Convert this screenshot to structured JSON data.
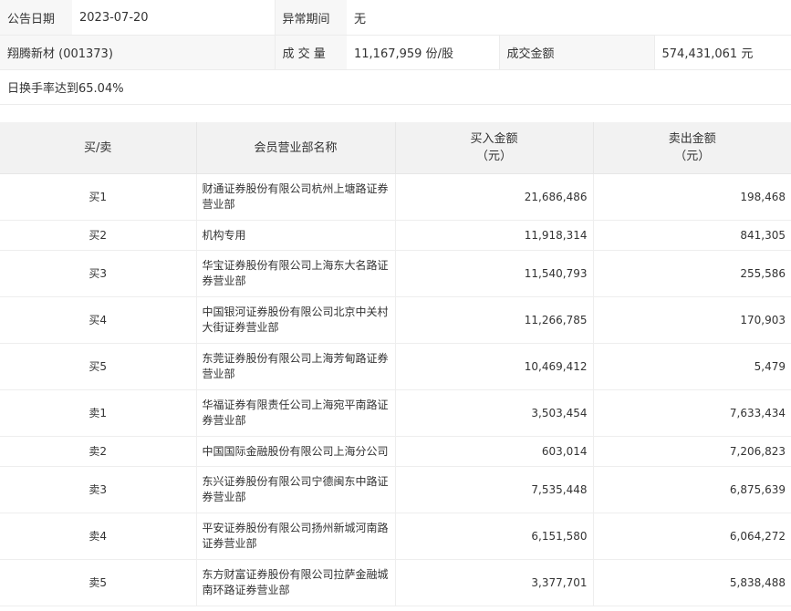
{
  "info": {
    "announce_date_label": "公告日期",
    "announce_date_value": "2023-07-20",
    "abnormal_period_label": "异常期间",
    "abnormal_period_value": "无",
    "stock": "翔腾新材 (001373)",
    "volume_label": "成 交 量",
    "volume_value": "11,167,959 份/股",
    "amount_label": "成交金额",
    "amount_value": "574,431,061 元",
    "reason": "日换手率达到65.04%"
  },
  "table": {
    "headers": {
      "side": "买/卖",
      "branch": "会员营业部名称",
      "buy_line1": "买入金额",
      "buy_line2": "（元）",
      "sell_line1": "卖出金额",
      "sell_line2": "（元）"
    },
    "rows": [
      {
        "side": "买1",
        "branch": "财通证券股份有限公司杭州上塘路证券营业部",
        "buy": "21,686,486",
        "sell": "198,468"
      },
      {
        "side": "买2",
        "branch": "机构专用",
        "buy": "11,918,314",
        "sell": "841,305"
      },
      {
        "side": "买3",
        "branch": "华宝证券股份有限公司上海东大名路证券营业部",
        "buy": "11,540,793",
        "sell": "255,586"
      },
      {
        "side": "买4",
        "branch": "中国银河证券股份有限公司北京中关村大街证券营业部",
        "buy": "11,266,785",
        "sell": "170,903"
      },
      {
        "side": "买5",
        "branch": "东莞证券股份有限公司上海芳甸路证券营业部",
        "buy": "10,469,412",
        "sell": "5,479"
      },
      {
        "side": "卖1",
        "branch": "华福证券有限责任公司上海宛平南路证券营业部",
        "buy": "3,503,454",
        "sell": "7,633,434"
      },
      {
        "side": "卖2",
        "branch": "中国国际金融股份有限公司上海分公司",
        "buy": "603,014",
        "sell": "7,206,823"
      },
      {
        "side": "卖3",
        "branch": "东兴证券股份有限公司宁德闽东中路证券营业部",
        "buy": "7,535,448",
        "sell": "6,875,639"
      },
      {
        "side": "卖4",
        "branch": "平安证券股份有限公司扬州新城河南路证券营业部",
        "buy": "6,151,580",
        "sell": "6,064,272"
      },
      {
        "side": "卖5",
        "branch": "东方财富证券股份有限公司拉萨金融城南环路证券营业部",
        "buy": "3,377,701",
        "sell": "5,838,488"
      }
    ]
  }
}
